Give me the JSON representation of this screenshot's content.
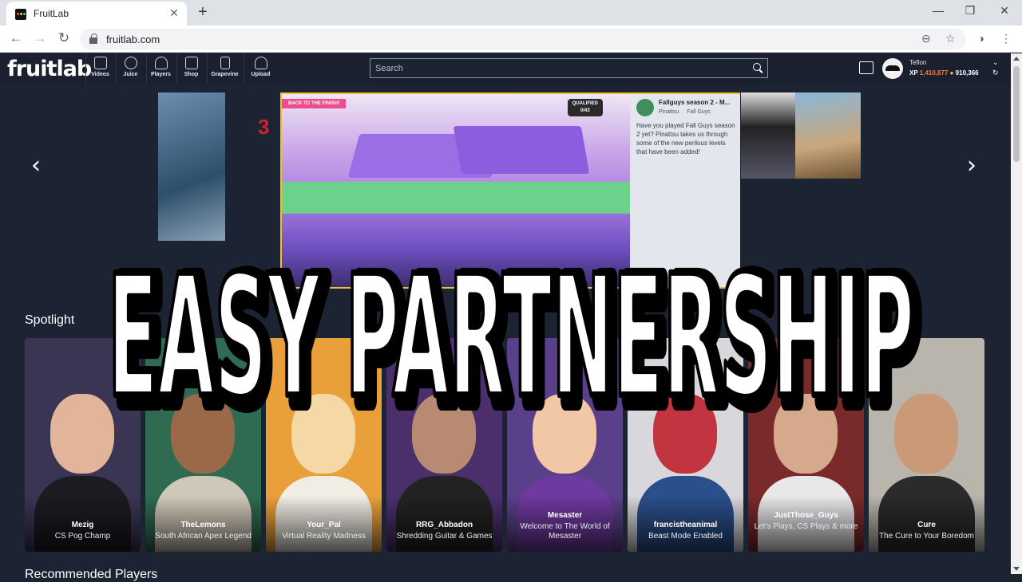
{
  "browser": {
    "tab_title": "FruitLab",
    "tab_close": "✕",
    "new_tab": "+",
    "minimize": "—",
    "maximize": "❐",
    "close": "✕",
    "url": "fruitlab.com"
  },
  "site": {
    "logo": "fruitlab",
    "nav": [
      {
        "label": "Videos",
        "icon": "video-icon"
      },
      {
        "label": "Juice",
        "icon": "chat-icon"
      },
      {
        "label": "Players",
        "icon": "player-icon"
      },
      {
        "label": "Shop",
        "icon": "cart-icon"
      },
      {
        "label": "Grapevine",
        "icon": "document-icon"
      },
      {
        "label": "Upload",
        "icon": "cloud-upload-icon"
      }
    ],
    "search_placeholder": "Search",
    "user": {
      "name": "Teflon",
      "xp_label": "XP",
      "xp_value": "1,410,877",
      "coins": "910,366"
    }
  },
  "carousel": {
    "prev": "‹",
    "next": "›",
    "rank_number": "3",
    "featured": {
      "badge": "BACK TO THE FINISH!",
      "qualified_label": "QUALIFIED",
      "qualified_value": "0/43",
      "title": "Fallguys season 2 - M...",
      "channel": "Pinattsu",
      "game": "Fall Guys",
      "description": "Have you played Fall Guys season 2 yet? Pinattsu takes us through some of the new perilous levels that have been added!"
    }
  },
  "spotlight": {
    "title": "Spotlight",
    "cards": [
      {
        "name": "Mezig",
        "tagline": "CS Pog Champ",
        "bg": "#3b3554",
        "skin": "#e2b49a",
        "body": "#1b1b22"
      },
      {
        "name": "TheLemons",
        "tagline": "South African Apex Legend",
        "bg": "#2e6b52",
        "skin": "#9a6a48",
        "body": "#cfc7b8"
      },
      {
        "name": "Your_Pal",
        "tagline": "Virtual Reality Madness",
        "bg": "#e9a03a",
        "skin": "#f5d8a6",
        "body": "#f0ede4"
      },
      {
        "name": "RRG_Abbadon",
        "tagline": "Shredding Guitar & Games",
        "bg": "#4a2f6b",
        "skin": "#b98a72",
        "body": "#222"
      },
      {
        "name": "Mesaster",
        "tagline": "Welcome to The World of Mesaster",
        "bg": "#5a3f8a",
        "skin": "#f2c7a6",
        "body": "#6f3aa0"
      },
      {
        "name": "francistheanimal",
        "tagline": "Beast Mode Enabled",
        "bg": "#d8d8dc",
        "skin": "#c23440",
        "body": "#2a4f8a"
      },
      {
        "name": "JustThose_Guys",
        "tagline": "Let's Plays, CS Plays & more",
        "bg": "#7a2a2a",
        "skin": "#d6a98c",
        "body": "#e8e8ea"
      },
      {
        "name": "Cure",
        "tagline": "The Cure to Your Boredom",
        "bg": "#b9b5ad",
        "skin": "#c99978",
        "body": "#2b2b2b"
      }
    ]
  },
  "below_section_title": "Recommended Players",
  "overlay_headline": "EASY PARTNERSHIP"
}
